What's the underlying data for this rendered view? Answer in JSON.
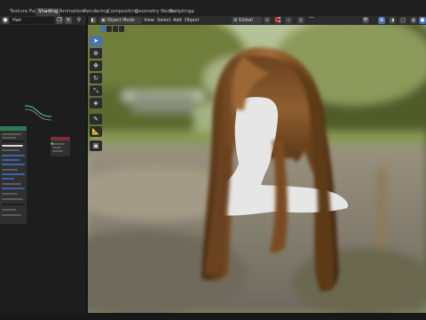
{
  "workspace_tabs": [
    {
      "label": "Texture Paint",
      "active": false
    },
    {
      "label": "Shading",
      "active": true
    },
    {
      "label": "Animation",
      "active": false
    },
    {
      "label": "Rendering",
      "active": false
    },
    {
      "label": "Compositing",
      "active": false
    },
    {
      "label": "Geometry Nodes",
      "active": false
    },
    {
      "label": "Scripting",
      "active": false
    }
  ],
  "add_workspace": "+",
  "node_editor": {
    "material_name": "Hair"
  },
  "viewport_header": {
    "mode": "Object Mode",
    "menus": [
      "View",
      "Select",
      "Add",
      "Object"
    ],
    "transform_orientation": "Global"
  },
  "tools": [
    {
      "name": "select-box",
      "glyph": "➤",
      "active": true
    },
    {
      "name": "cursor",
      "glyph": "⊕",
      "active": false
    },
    {
      "name": "move",
      "glyph": "✥",
      "active": false
    },
    {
      "name": "rotate",
      "glyph": "↻",
      "active": false
    },
    {
      "name": "scale",
      "glyph": "⤡",
      "active": false
    },
    {
      "name": "transform",
      "glyph": "◈",
      "active": false
    },
    {
      "name": "annotate",
      "glyph": "✎",
      "active": false
    },
    {
      "name": "measure",
      "glyph": "📐",
      "active": false
    },
    {
      "name": "add-cube",
      "glyph": "▣",
      "active": false
    }
  ],
  "colors": {
    "accent": "#4772b3",
    "active_tab": "#3d3d3d",
    "panel": "#2b2b2b",
    "background": "#1d1d1d",
    "hair": "#7a4a24",
    "mannequin": "#e6e6e6"
  }
}
